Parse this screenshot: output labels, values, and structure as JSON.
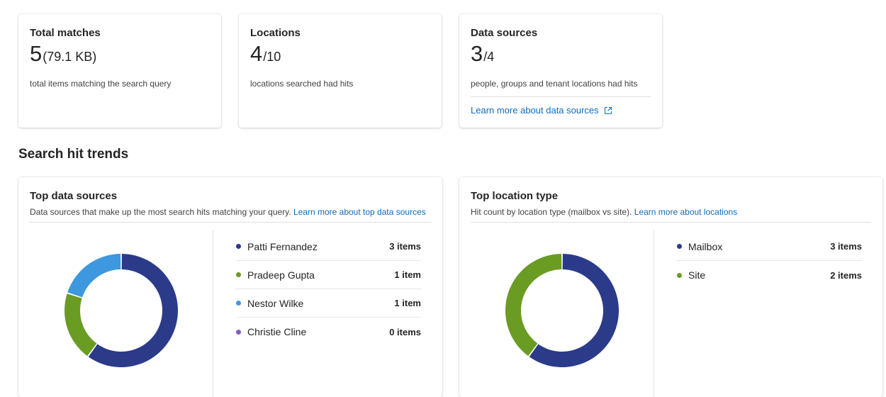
{
  "stats": [
    {
      "title": "Total matches",
      "value": "5",
      "suffix": "(79.1 KB)",
      "desc": "total items matching the search query"
    },
    {
      "title": "Locations",
      "value": "4",
      "suffix": "/10",
      "desc": "locations searched had hits"
    },
    {
      "title": "Data sources",
      "value": "3",
      "suffix": "/4",
      "desc": "people, groups and tenant locations had hits",
      "link": "Learn more about data sources"
    }
  ],
  "section_title": "Search hit trends",
  "top_sources": {
    "title": "Top data sources",
    "subtitle": "Data sources that make up the most search hits matching your query. ",
    "link": "Learn more about top data sources",
    "items": [
      {
        "name": "Patti Fernandez",
        "count_label": "3 items",
        "value": 3,
        "color": "#2b3b8a"
      },
      {
        "name": "Pradeep Gupta",
        "count_label": "1 item",
        "value": 1,
        "color": "#6a9b23"
      },
      {
        "name": "Nestor Wilke",
        "count_label": "1 item",
        "value": 1,
        "color": "#3d98e0"
      },
      {
        "name": "Christie Cline",
        "count_label": "0 items",
        "value": 0,
        "color": "#8a5cc2"
      }
    ]
  },
  "top_location": {
    "title": "Top location type",
    "subtitle": "Hit count by location type (mailbox vs site). ",
    "link": "Learn more about locations",
    "items": [
      {
        "name": "Mailbox",
        "count_label": "3 items",
        "value": 3,
        "color": "#2b3b8a"
      },
      {
        "name": "Site",
        "count_label": "2 items",
        "value": 2,
        "color": "#6a9b23"
      }
    ]
  },
  "link_color": "#0f6cbd",
  "icons": {
    "external": "open-in-new-window-icon"
  }
}
